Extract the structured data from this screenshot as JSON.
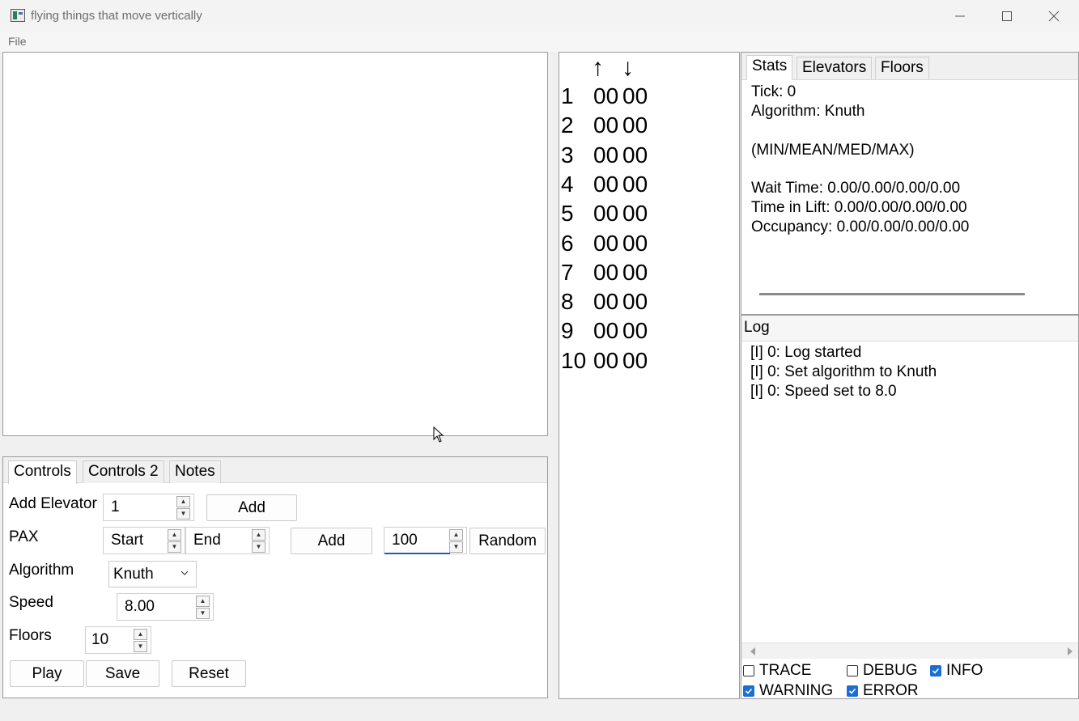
{
  "window": {
    "title": "flying things that move vertically",
    "minimize_icon": "minimize-icon",
    "maximize_icon": "maximize-icon",
    "close_icon": "close-icon"
  },
  "menu": {
    "file": "File"
  },
  "controls": {
    "tabs": [
      "Controls",
      "Controls 2",
      "Notes"
    ],
    "add_elevator": {
      "label": "Add Elevator",
      "value": "1",
      "button": "Add"
    },
    "pax": {
      "label": "PAX",
      "start": "Start",
      "end": "End",
      "add_button": "Add",
      "count": "100",
      "random_button": "Random"
    },
    "algorithm": {
      "label": "Algorithm",
      "selected": "Knuth"
    },
    "speed": {
      "label": "Speed",
      "value": "8.00"
    },
    "floors": {
      "label": "Floors",
      "value": "10"
    },
    "buttons": {
      "play": "Play",
      "save": "Save",
      "reset": "Reset"
    }
  },
  "floor_panel": {
    "up_arrow": "↑",
    "down_arrow": "↓",
    "rows": [
      {
        "floor": "1",
        "up": "00",
        "down": "00"
      },
      {
        "floor": "2",
        "up": "00",
        "down": "00"
      },
      {
        "floor": "3",
        "up": "00",
        "down": "00"
      },
      {
        "floor": "4",
        "up": "00",
        "down": "00"
      },
      {
        "floor": "5",
        "up": "00",
        "down": "00"
      },
      {
        "floor": "6",
        "up": "00",
        "down": "00"
      },
      {
        "floor": "7",
        "up": "00",
        "down": "00"
      },
      {
        "floor": "8",
        "up": "00",
        "down": "00"
      },
      {
        "floor": "9",
        "up": "00",
        "down": "00"
      },
      {
        "floor": "10",
        "up": "00",
        "down": "00"
      }
    ]
  },
  "stats": {
    "tabs": [
      "Stats",
      "Elevators",
      "Floors"
    ],
    "tick": "Tick: 0",
    "algorithm": "Algorithm: Knuth",
    "legend": "(MIN/MEAN/MED/MAX)",
    "wait_time": "Wait Time: 0.00/0.00/0.00/0.00",
    "time_in_lift": "Time in Lift: 0.00/0.00/0.00/0.00",
    "occupancy": "Occupancy: 0.00/0.00/0.00/0.00"
  },
  "log": {
    "title": "Log",
    "entries": [
      "[I] 0: Log started",
      "[I] 0: Set algorithm to Knuth",
      "[I] 0: Speed set to 8.0"
    ],
    "levels": [
      {
        "label": "TRACE",
        "checked": false
      },
      {
        "label": "DEBUG",
        "checked": false
      },
      {
        "label": "INFO",
        "checked": true
      },
      {
        "label": "WARNING",
        "checked": true
      },
      {
        "label": "ERROR",
        "checked": true
      }
    ]
  },
  "colors": {
    "accent": "#1a6fd0",
    "focus": "#1b5fb0",
    "border": "#9a9a9a"
  }
}
